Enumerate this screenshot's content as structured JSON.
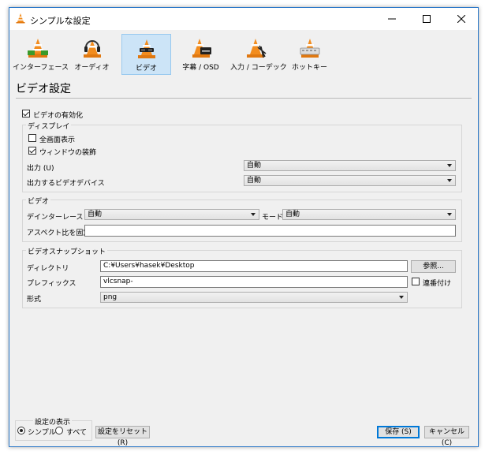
{
  "window": {
    "title": "シンプルな設定",
    "controls": {
      "minimize": "minimize-icon",
      "maximize": "maximize-icon",
      "close": "close-icon"
    }
  },
  "toolbar": {
    "items": [
      {
        "label": "インターフェース",
        "icon": "interface-cone-icon",
        "selected": false
      },
      {
        "label": "オーディオ",
        "icon": "headphones-cone-icon",
        "selected": false
      },
      {
        "label": "ビデオ",
        "icon": "glasses-cone-icon",
        "selected": true
      },
      {
        "label": "字幕 / OSD",
        "icon": "subtitle-cone-icon",
        "selected": false
      },
      {
        "label": "入力 / コーデック",
        "icon": "codec-cone-icon",
        "selected": false
      },
      {
        "label": "ホットキー",
        "icon": "hotkey-cone-icon",
        "selected": false
      }
    ]
  },
  "page": {
    "heading": "ビデオ設定",
    "enable_video": {
      "label": "ビデオの有効化",
      "checked": true
    }
  },
  "display": {
    "title": "ディスプレイ",
    "fullscreen": {
      "label": "全画面表示",
      "checked": false
    },
    "decorations": {
      "label": "ウィンドウの装飾",
      "checked": true
    },
    "output_label": "出力 (U)",
    "output_value": "自動",
    "device_label": "出力するビデオデバイス",
    "device_value": "自動"
  },
  "video": {
    "title": "ビデオ",
    "deinterlace_label": "デインターレース",
    "deinterlace_value": "自動",
    "mode_label": "モード",
    "mode_value": "自動",
    "aspect_label": "アスペクト比を固定",
    "aspect_value": ""
  },
  "snapshot": {
    "title": "ビデオスナップショット",
    "dir_label": "ディレクトリ",
    "dir_value": "C:¥Users¥hasek¥Desktop",
    "browse_label": "参照...",
    "prefix_label": "プレフィックス",
    "prefix_value": "vlcsnap-",
    "sequential": {
      "label": "連番付け",
      "checked": false
    },
    "format_label": "形式",
    "format_value": "png"
  },
  "footer": {
    "show_settings_title": "設定の表示",
    "simple_label": "シンプル",
    "all_label": "すべて",
    "selected": "simple",
    "reset_label": "設定をリセット (R)",
    "save_label": "保存 (S)",
    "cancel_label": "キャンセル (C)"
  },
  "colors": {
    "selection_bg": "#cce4f7",
    "selection_border": "#99c9ef",
    "window_border": "#2b78c8",
    "cone_orange": "#f28c1e"
  }
}
